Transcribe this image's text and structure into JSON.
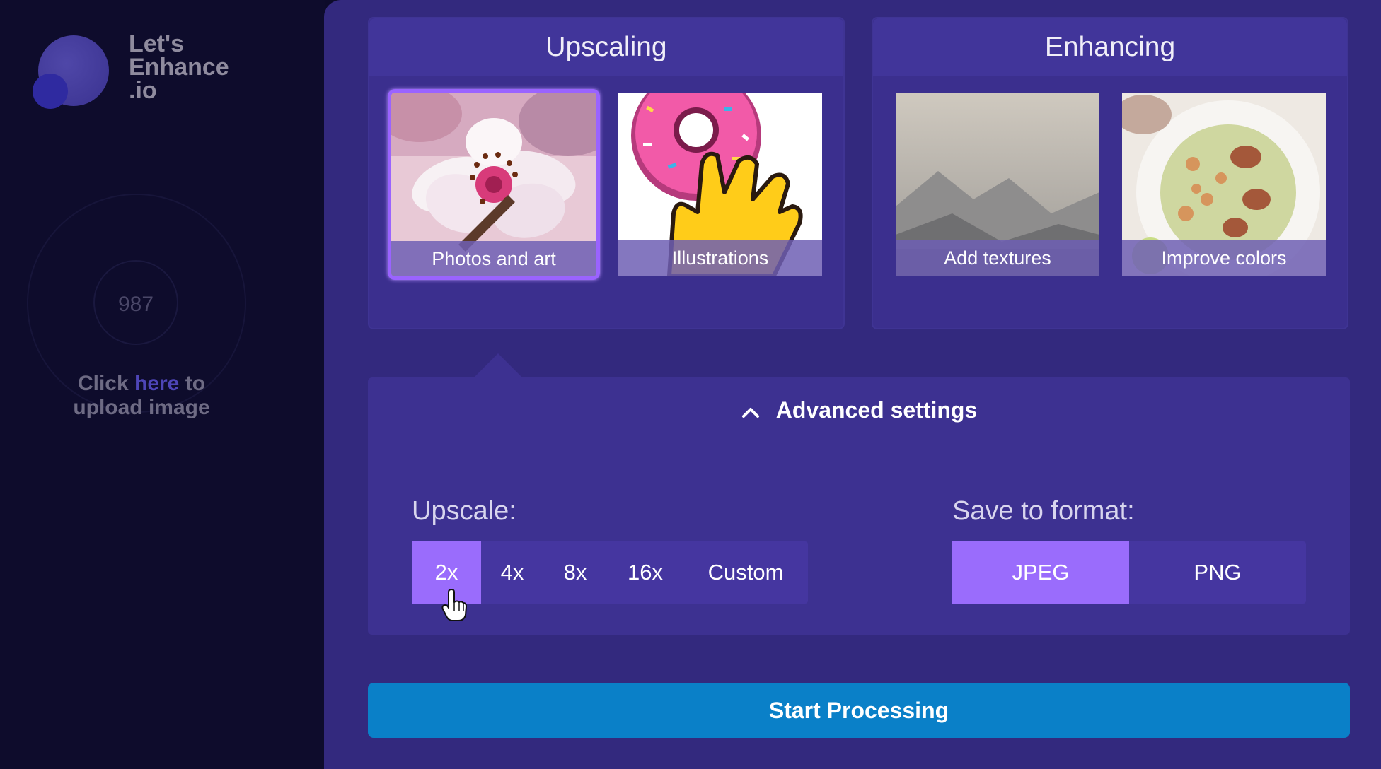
{
  "brand": {
    "logo_text_line1": "Let's",
    "logo_text_line2": "Enhance",
    "logo_text_line3": ".io"
  },
  "sidebar": {
    "counter": "987",
    "upload_prefix": "Click ",
    "upload_link": "here",
    "upload_suffix": " to",
    "upload_line2": "upload image"
  },
  "panels": {
    "upscaling": {
      "title": "Upscaling",
      "cards": [
        {
          "label": "Photos and art",
          "selected": true
        },
        {
          "label": "Illustrations",
          "selected": false
        }
      ]
    },
    "enhancing": {
      "title": "Enhancing",
      "cards": [
        {
          "label": "Add textures"
        },
        {
          "label": "Improve colors"
        }
      ]
    }
  },
  "advanced": {
    "title": "Advanced settings",
    "upscale_label": "Upscale:",
    "upscale_options": [
      "2x",
      "4x",
      "8x",
      "16x",
      "Custom"
    ],
    "upscale_selected": "2x",
    "format_label": "Save to format:",
    "format_options": [
      "JPEG",
      "PNG"
    ],
    "format_selected": "JPEG"
  },
  "actions": {
    "start": "Start Processing"
  },
  "colors": {
    "accent": "#9a6cfc",
    "primary_button": "#0a80c8",
    "main_bg": "#33297e"
  },
  "icons": [
    "chevron-up-icon",
    "hand-pointer-icon"
  ]
}
